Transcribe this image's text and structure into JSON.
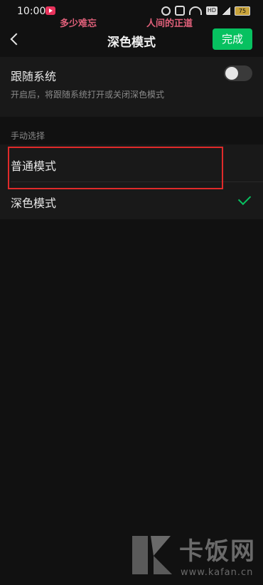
{
  "status_bar": {
    "time": "10:00",
    "overlay_left": "多少难忘",
    "overlay_right": "人间的正道",
    "hd_label": "HD",
    "battery": "75"
  },
  "header": {
    "title": "深色模式",
    "done_label": "完成"
  },
  "follow_system": {
    "label": "跟随系统",
    "description": "开启后，将跟随系统打开或关闭深色模式",
    "enabled": false
  },
  "manual": {
    "section_label": "手动选择",
    "options": [
      {
        "label": "普通模式",
        "selected": false
      },
      {
        "label": "深色模式",
        "selected": true
      }
    ]
  },
  "watermark": {
    "brand": "卡饭网",
    "url": "www.kafan.cn"
  },
  "colors": {
    "accent": "#07c160",
    "highlight": "#e02a2a",
    "background": "#111111"
  }
}
